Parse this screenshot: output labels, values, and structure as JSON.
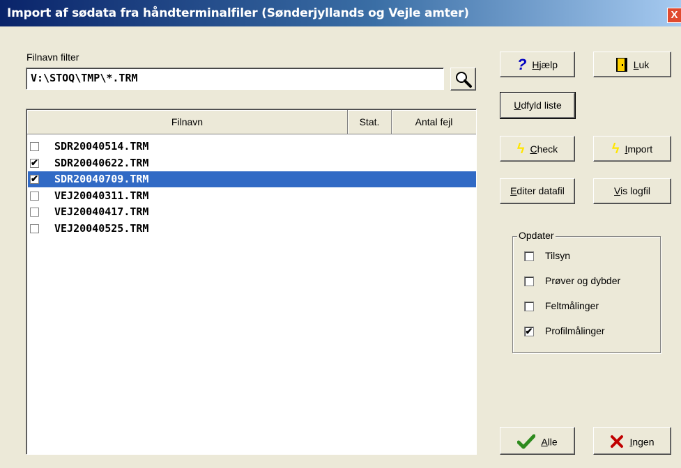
{
  "window": {
    "title": "Import af sødata fra håndterminalfiler (Sønderjyllands og Vejle amter)",
    "close": "X"
  },
  "filter": {
    "label": "Filnavn filter",
    "value": "V:\\STOQ\\TMP\\*.TRM"
  },
  "buttons": {
    "help": {
      "key": "H",
      "rest": "jælp"
    },
    "close": {
      "key": "L",
      "rest": "uk"
    },
    "fill": {
      "key": "U",
      "rest": "dfyld liste"
    },
    "check": {
      "key": "C",
      "rest": "heck"
    },
    "import": {
      "key": "I",
      "rest": "mport"
    },
    "edit": {
      "key": "E",
      "rest": "diter datafil"
    },
    "log": {
      "key": "V",
      "rest": "is logfil"
    },
    "all": {
      "key": "A",
      "rest": "lle"
    },
    "none": {
      "key": "I",
      "rest": "ngen"
    }
  },
  "list": {
    "columns": [
      "Filnavn",
      "Stat.",
      "Antal fejl"
    ],
    "rows": [
      {
        "name": "SDR20040514.TRM",
        "checked": false,
        "selected": false
      },
      {
        "name": "SDR20040622.TRM",
        "checked": true,
        "selected": false
      },
      {
        "name": "SDR20040709.TRM",
        "checked": true,
        "selected": true
      },
      {
        "name": "VEJ20040311.TRM",
        "checked": false,
        "selected": false
      },
      {
        "name": "VEJ20040417.TRM",
        "checked": false,
        "selected": false
      },
      {
        "name": "VEJ20040525.TRM",
        "checked": false,
        "selected": false
      }
    ]
  },
  "update": {
    "label": "Opdater",
    "options": [
      {
        "label": "Tilsyn",
        "checked": false
      },
      {
        "label": "Prøver og dybder",
        "checked": false
      },
      {
        "label": "Feltmålinger",
        "checked": false
      },
      {
        "label": "Profilmålinger",
        "checked": true
      }
    ]
  },
  "colors": {
    "titlebar": "#0a246a",
    "selection": "#316ac5",
    "face": "#ece9d8"
  }
}
